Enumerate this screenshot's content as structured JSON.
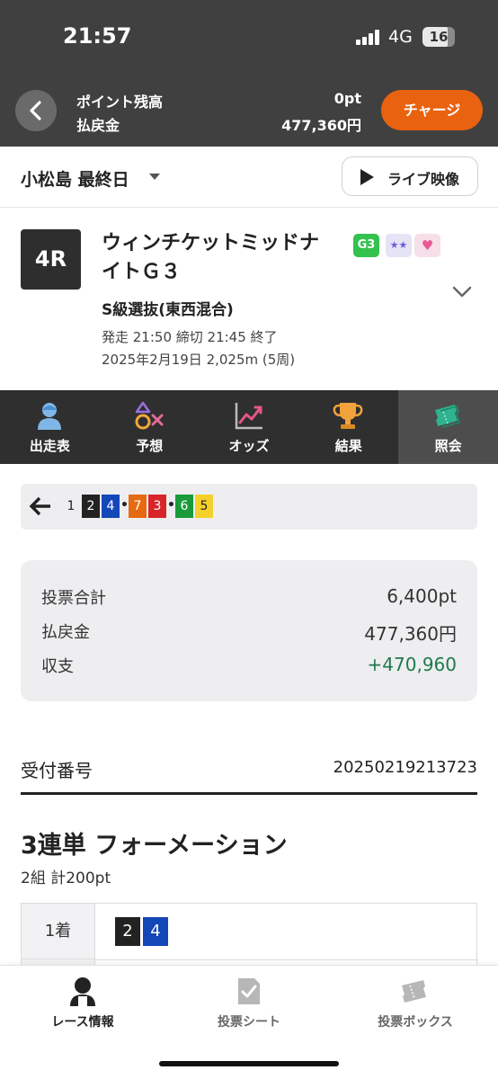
{
  "status_bar": {
    "time": "21:57",
    "network": "4G",
    "battery": "16"
  },
  "points_bar": {
    "point_label": "ポイント残高",
    "refund_label": "払戻金",
    "point_value": "0pt",
    "refund_value": "477,360円",
    "charge_label": "チャージ"
  },
  "venue": {
    "name": "小松島 最終日",
    "live_label": "ライブ映像"
  },
  "race": {
    "number": "4R",
    "title": "ウィンチケットミッドナイトＧ３",
    "grade_badge": "G3",
    "star_badge": "★★",
    "heart_badge": "♥",
    "class": "S級選抜(東西混合)",
    "time_info": "発走 21:50 締切 21:45  終了",
    "date_info": "2025年2月19日 2,025m (5周)"
  },
  "tabs": [
    {
      "label": "出走表",
      "icon": "racer-icon"
    },
    {
      "label": "予想",
      "icon": "prediction-icon"
    },
    {
      "label": "オッズ",
      "icon": "odds-chart-icon"
    },
    {
      "label": "結果",
      "icon": "trophy-icon"
    },
    {
      "label": "照会",
      "icon": "ticket-icon"
    }
  ],
  "bet_sequence": {
    "numbers": [
      {
        "n": "1",
        "bg": "#eeeef0",
        "fg": "#222222"
      },
      {
        "n": "2",
        "bg": "#222222",
        "fg": "#ffffff"
      },
      {
        "n": "4",
        "bg": "#1447b8",
        "fg": "#ffffff"
      },
      {
        "n": "7",
        "bg": "#e66a12",
        "fg": "#ffffff"
      },
      {
        "n": "3",
        "bg": "#d8252a",
        "fg": "#ffffff"
      },
      {
        "n": "6",
        "bg": "#1a9a3a",
        "fg": "#ffffff"
      },
      {
        "n": "5",
        "bg": "#f5d02a",
        "fg": "#222222"
      }
    ]
  },
  "summary": {
    "total_label": "投票合計",
    "total_value": "6,400pt",
    "refund_label": "払戻金",
    "refund_value": "477,360円",
    "balance_label": "収支",
    "balance_value": "+470,960",
    "balance_color": "#1e7a4c"
  },
  "receipt": {
    "label": "受付番号",
    "value": "20250219213723"
  },
  "bet_detail": {
    "type": "3連単 フォーメーション",
    "summary": "2組 計200pt",
    "rows": [
      {
        "label": "1着",
        "numbers": [
          {
            "n": "2",
            "bg": "#222222",
            "fg": "#ffffff"
          },
          {
            "n": "4",
            "bg": "#1447b8",
            "fg": "#ffffff"
          }
        ]
      }
    ]
  },
  "bottom_nav": [
    {
      "label": "レース情報",
      "icon": "race-info-icon",
      "active": true
    },
    {
      "label": "投票シート",
      "icon": "vote-sheet-icon",
      "active": false
    },
    {
      "label": "投票ボックス",
      "icon": "vote-box-icon",
      "active": false
    }
  ]
}
